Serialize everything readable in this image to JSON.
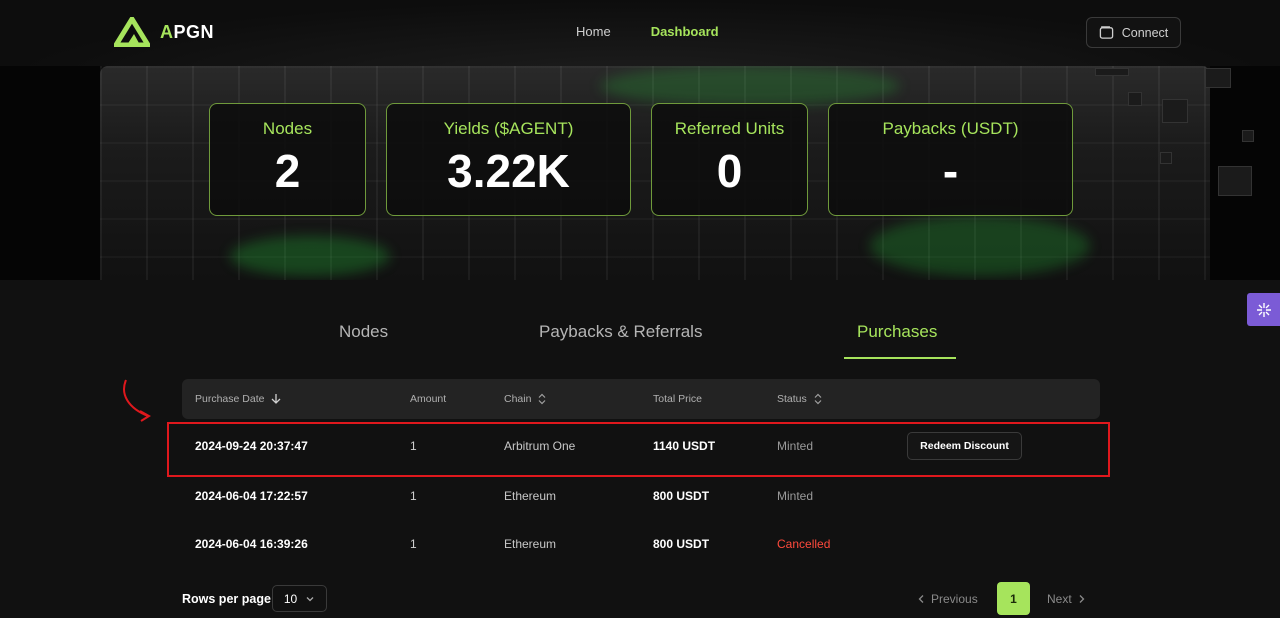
{
  "header": {
    "logo_accent": "A",
    "logo_rest": "PGN",
    "nav": {
      "home": "Home",
      "dashboard": "Dashboard"
    },
    "connect_label": "Connect"
  },
  "stats": [
    {
      "label": "Nodes",
      "value": "2"
    },
    {
      "label": "Yields ($AGENT)",
      "value": "3.22K"
    },
    {
      "label": "Referred Units",
      "value": "0"
    },
    {
      "label": "Paybacks (USDT)",
      "value": "-"
    }
  ],
  "tabs": {
    "nodes": "Nodes",
    "paybacks": "Paybacks & Referrals",
    "purchases": "Purchases",
    "active": "Purchases"
  },
  "table": {
    "headers": {
      "date": "Purchase Date",
      "amount": "Amount",
      "chain": "Chain",
      "price": "Total Price",
      "status": "Status"
    },
    "rows": [
      {
        "date": "2024-09-24 20:37:47",
        "amount": "1",
        "chain": "Arbitrum One",
        "price": "1140 USDT",
        "status": "Minted",
        "action": "Redeem Discount"
      },
      {
        "date": "2024-06-04 17:22:57",
        "amount": "1",
        "chain": "Ethereum",
        "price": "800 USDT",
        "status": "Minted"
      },
      {
        "date": "2024-06-04 16:39:26",
        "amount": "1",
        "chain": "Ethereum",
        "price": "800 USDT",
        "status": "Cancelled"
      }
    ]
  },
  "pagination": {
    "rows_per_page_label": "Rows per page",
    "rows_per_page_value": "10",
    "previous": "Previous",
    "current_page": "1",
    "next": "Next"
  },
  "colors": {
    "accent": "#a6e45c",
    "cancelled": "#ff4a3c",
    "highlight": "#e0181d",
    "fab": "#7b5bd6"
  }
}
